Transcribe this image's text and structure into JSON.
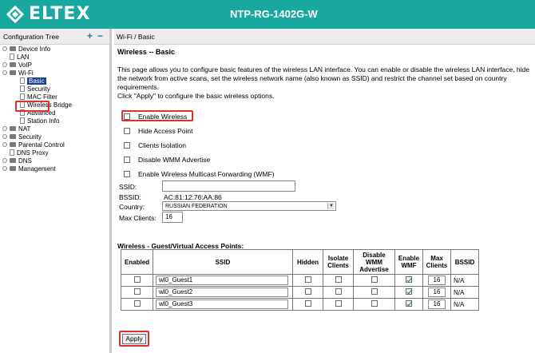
{
  "header": {
    "logo_text": "ELTEX",
    "model": "NTP-RG-1402G-W",
    "bg_color": "#18a8a0"
  },
  "sidebar": {
    "title": "Configuration Tree",
    "tools": [
      "+",
      "−"
    ],
    "items": [
      {
        "label": "Device Info",
        "level": 0,
        "icon": "folder"
      },
      {
        "label": "LAN",
        "level": 0,
        "icon": "page"
      },
      {
        "label": "VoIP",
        "level": 0,
        "icon": "folder"
      },
      {
        "label": "Wi-Fi",
        "level": 0,
        "icon": "folder-open"
      },
      {
        "label": "Basic",
        "level": 1,
        "icon": "page",
        "selected": true
      },
      {
        "label": "Security",
        "level": 1,
        "icon": "page"
      },
      {
        "label": "MAC Filter",
        "level": 1,
        "icon": "page"
      },
      {
        "label": "Wireless Bridge",
        "level": 1,
        "icon": "page"
      },
      {
        "label": "Advanced",
        "level": 1,
        "icon": "page"
      },
      {
        "label": "Station Info",
        "level": 1,
        "icon": "page"
      },
      {
        "label": "NAT",
        "level": 0,
        "icon": "folder"
      },
      {
        "label": "Security",
        "level": 0,
        "icon": "folder"
      },
      {
        "label": "Parental Control",
        "level": 0,
        "icon": "folder"
      },
      {
        "label": "DNS Proxy",
        "level": 0,
        "icon": "page"
      },
      {
        "label": "DNS",
        "level": 0,
        "icon": "folder"
      },
      {
        "label": "Management",
        "level": 0,
        "icon": "folder"
      }
    ]
  },
  "main": {
    "breadcrumb": "Wi-Fi / Basic",
    "title": "Wireless -- Basic",
    "description": "This page allows you to configure basic features of the wireless LAN interface. You can enable or disable the wireless LAN interface, hide the network from active scans, set the wireless network name (also known as SSID) and restrict the channel set based on country requirements.",
    "instruction": "Click \"Apply\" to configure the basic wireless options.",
    "options": [
      {
        "label": "Enable Wireless",
        "checked": false
      },
      {
        "label": "Hide Access Point",
        "checked": false
      },
      {
        "label": "Clients Isolation",
        "checked": false
      },
      {
        "label": "Disable WMM Advertise",
        "checked": false
      },
      {
        "label": "Enable Wireless Multicast Forwarding (WMF)",
        "checked": false
      }
    ],
    "ssid_label": "SSID:",
    "ssid_value": "",
    "bssid_label": "BSSID:",
    "bssid_value": "AC:81:12:76:AA:86",
    "country_label": "Country:",
    "country_value": "RUSSIAN FEDERATION",
    "max_clients_label": "Max Clients:",
    "max_clients_value": "16"
  },
  "guest": {
    "title": "Wireless - Guest/Virtual Access Points:",
    "headers": [
      "Enabled",
      "SSID",
      "Hidden",
      "Isolate Clients",
      "Disable WMM Advertise",
      "Enable WMF",
      "Max Clients",
      "BSSID"
    ],
    "rows": [
      {
        "enabled": false,
        "ssid": "wl0_Guest1",
        "hidden": false,
        "isolate": false,
        "disable_wmm": false,
        "enable_wmf": true,
        "max_clients": "16",
        "bssid": "N/A"
      },
      {
        "enabled": false,
        "ssid": "wl0_Guest2",
        "hidden": false,
        "isolate": false,
        "disable_wmm": false,
        "enable_wmf": true,
        "max_clients": "16",
        "bssid": "N/A"
      },
      {
        "enabled": false,
        "ssid": "wl0_Guest3",
        "hidden": false,
        "isolate": false,
        "disable_wmm": false,
        "enable_wmf": true,
        "max_clients": "16",
        "bssid": "N/A"
      }
    ]
  },
  "apply_label": "Apply",
  "annotation_color": "#e03030"
}
